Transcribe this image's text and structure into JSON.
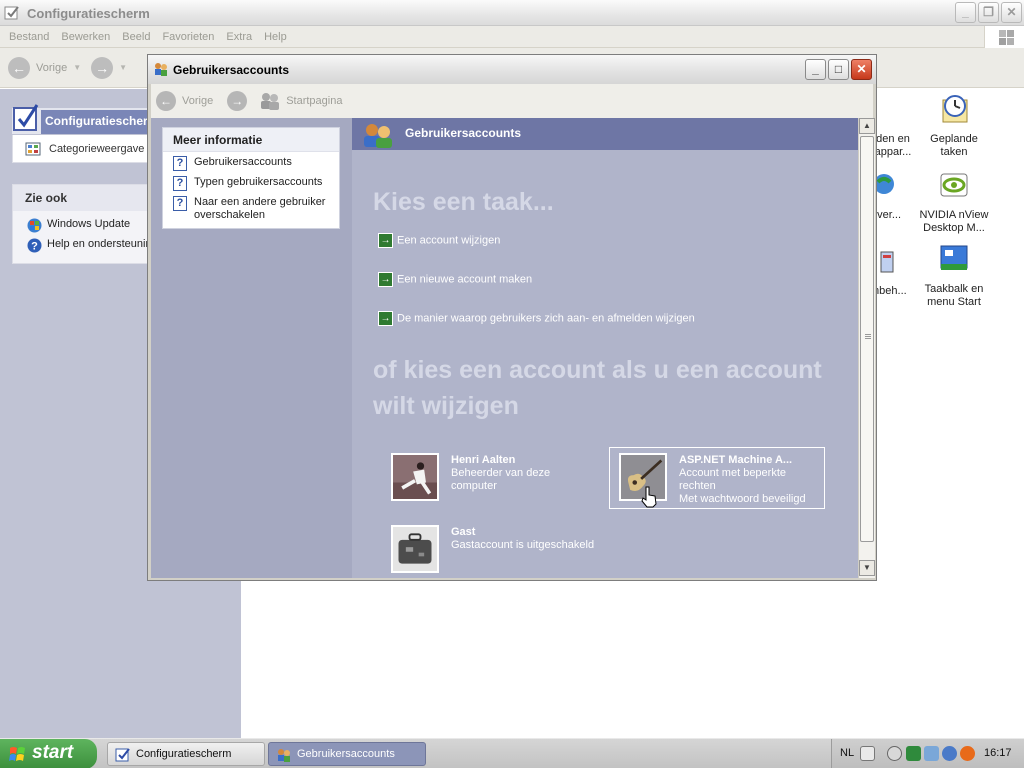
{
  "bg_window": {
    "title": "Configuratiescherm",
    "menu": [
      "Bestand",
      "Bewerken",
      "Beeld",
      "Favorieten",
      "Extra",
      "Help"
    ],
    "toolbar": {
      "back_label": "Vorige"
    },
    "left_panel": {
      "header": "Configuratiescherm",
      "category_view": "Categorieweergave",
      "see_also": {
        "title": "Zie ook",
        "items": [
          "Windows Update",
          "Help en ondersteuning"
        ]
      }
    }
  },
  "desktop_icons": [
    {
      "label": "den en\nappar..."
    },
    {
      "label": "Geplande\ntaken"
    },
    {
      "label": "rkver..."
    },
    {
      "label": "NVIDIA nView\nDesktop M..."
    },
    {
      "label": "mbeh..."
    },
    {
      "label": "Taakbalk en\nmenu Start"
    }
  ],
  "fg_window": {
    "title": "Gebruikersaccounts",
    "toolbar": {
      "back_label": "Vorige",
      "home_label": "Startpagina"
    },
    "sidebar": {
      "title": "Meer informatie",
      "items": [
        "Gebruikersaccounts",
        "Typen gebruikersaccounts",
        "Naar een andere gebruiker overschakelen"
      ]
    },
    "main": {
      "header": "Gebruikersaccounts",
      "pick_task": "Kies een taak...",
      "tasks": [
        "Een account wijzigen",
        "Een nieuwe account maken",
        "De manier waarop gebruikers zich aan- en afmelden wijzigen"
      ],
      "pick_account": "of kies een account als u een account wilt wijzigen",
      "accounts": [
        {
          "name": "Henri Aalten",
          "desc": "Beheerder van deze computer"
        },
        {
          "name": "ASP.NET Machine A...",
          "desc": "Account met beperkte rechten\nMet wachtwoord beveiligd"
        },
        {
          "name": "Gast",
          "desc": "Gastaccount is uitgeschakeld"
        }
      ]
    }
  },
  "taskbar": {
    "start_label": "start",
    "buttons": [
      "Configuratiescherm",
      "Gebruikersaccounts"
    ],
    "language": "NL",
    "clock": "16:17"
  }
}
